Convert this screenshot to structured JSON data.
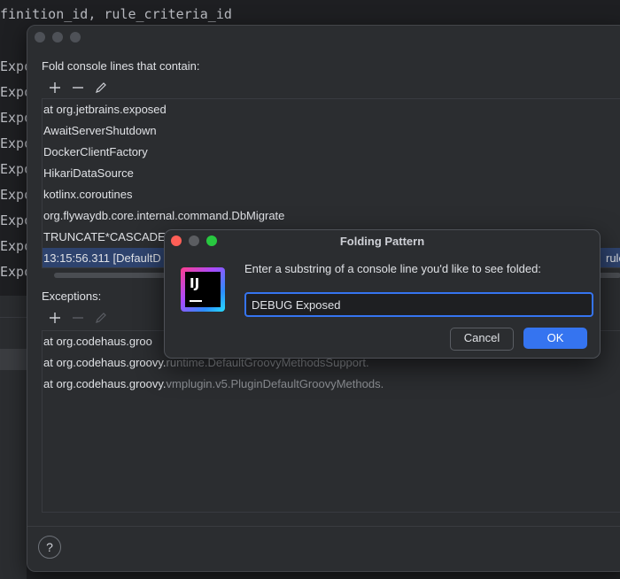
{
  "editor": {
    "top_line": "finition_id, rule_criteria_id",
    "gutter_fragment": "Expo"
  },
  "dialog": {
    "fold_label": "Fold console lines that contain:",
    "fold_items": [
      "at org.jetbrains.exposed",
      "AwaitServerShutdown",
      "DockerClientFactory",
      "HikariDataSource",
      "kotlinx.coroutines",
      "org.flywaydb.core.internal.command.DbMigrate",
      "TRUNCATE*CASCADE",
      "13:15:56.311 [DefaultD"
    ],
    "fold_item_selected_tail": "rule",
    "exceptions_label": "Exceptions:",
    "exception_items": [
      {
        "main": "at org.codehaus.groo",
        "grey": ""
      },
      {
        "main": "at org.codehaus.groovy.",
        "grey": "runtime.DefaultGroovyMethodsSupport."
      },
      {
        "main": "at org.codehaus.groovy.",
        "grey": "vmplugin.v5.PluginDefaultGroovyMethods."
      }
    ],
    "help_label": "?"
  },
  "popup": {
    "title": "Folding Pattern",
    "logo_text": "IJ",
    "prompt": "Enter a substring of a console line you'd like to see folded:",
    "input_value": "DEBUG Exposed",
    "cancel_label": "Cancel",
    "ok_label": "OK"
  },
  "colors": {
    "accent": "#3574f0",
    "selection": "#2e436e",
    "light_close": "#ff5f57",
    "light_min": "#6e6e6e",
    "light_max": "#28c840"
  },
  "icons": {
    "add": "add-icon",
    "remove": "remove-icon",
    "edit": "edit-pencil-icon"
  }
}
